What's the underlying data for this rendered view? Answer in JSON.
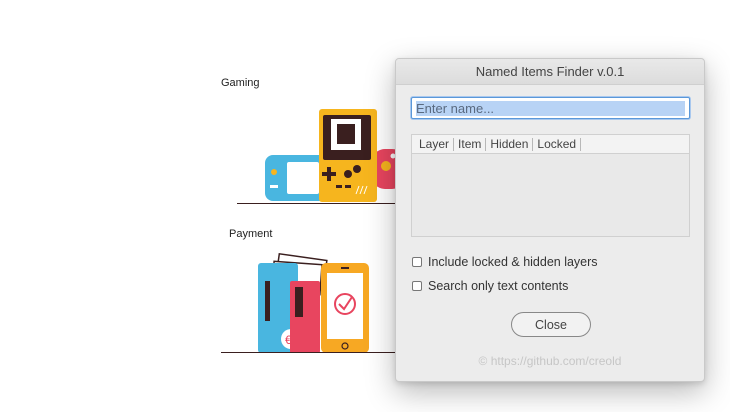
{
  "artboards": {
    "gaming_label": "Gaming",
    "payment_label": "Payment"
  },
  "dialog": {
    "title": "Named Items Finder v.0.1",
    "search_placeholder": "Enter name...",
    "columns": [
      "Layer",
      "Item",
      "Hidden",
      "Locked"
    ],
    "option_include_locked_hidden": "Include locked & hidden layers",
    "option_search_text_only": "Search only text contents",
    "close_label": "Close",
    "footer_link": "© https://github.com/creold"
  },
  "colors": {
    "dialog_bg": "#ececec",
    "accent_focus": "#5b98d9",
    "console_yellow": "#f6b51e",
    "switch_blue": "#49b6e0",
    "wallet_red": "#e8455f",
    "phone_orange": "#f7a823"
  }
}
